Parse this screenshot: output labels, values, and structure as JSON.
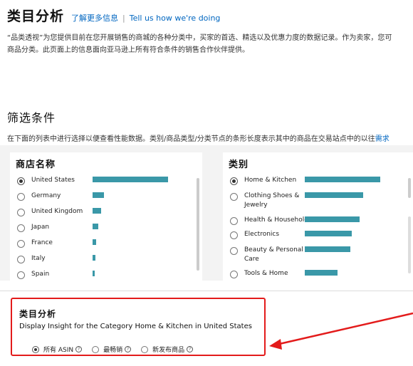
{
  "header": {
    "title": "类目分析",
    "learn_more": "了解更多信息",
    "separator": "|",
    "tell_us": "Tell us how we're doing",
    "desc_line1": "“品类透视”为您提供目前在您开展销售的商城的各种分类中，买家的首选、精选以及优惠力度的数据记录。作为卖家，您可",
    "desc_line2": "商品分类。此页面上的信息面向亚马逊上所有符合条件的销售合作伙伴提供。"
  },
  "filter": {
    "title": "筛选条件",
    "desc": "在下面的列表中进行选择以便查看性能数据。类别/商品类型/分类节点的条形长度表示其中的商品在交易站点中的以往",
    "desc_link": "需求"
  },
  "store_panel": {
    "title": "商店名称",
    "items": [
      {
        "label": "United States",
        "checked": true,
        "bar": 1.0
      },
      {
        "label": "Germany",
        "checked": false,
        "bar": 0.15
      },
      {
        "label": "United Kingdom",
        "checked": false,
        "bar": 0.11
      },
      {
        "label": "Japan",
        "checked": false,
        "bar": 0.08
      },
      {
        "label": "France",
        "checked": false,
        "bar": 0.05
      },
      {
        "label": "Italy",
        "checked": false,
        "bar": 0.04
      },
      {
        "label": "Spain",
        "checked": false,
        "bar": 0.03
      }
    ]
  },
  "category_panel": {
    "title": "类别",
    "items": [
      {
        "label": "Home & Kitchen",
        "checked": true,
        "bar": 1.0
      },
      {
        "label": "Clothing Shoes & Jewelry",
        "line1": "Clothing Shoes &",
        "line2": "Jewelry",
        "checked": false,
        "bar": 0.77
      },
      {
        "label": "Health & Household",
        "checked": false,
        "bar": 0.73
      },
      {
        "label": "Electronics",
        "checked": false,
        "bar": 0.62
      },
      {
        "label": "Beauty & Personal Care",
        "line1": "Beauty & Personal",
        "line2": "Care",
        "checked": false,
        "bar": 0.6
      },
      {
        "label": "Tools & Home",
        "checked": false,
        "bar": 0.43
      }
    ]
  },
  "insight": {
    "title": "类目分析",
    "subtitle": "Display Insight for the Category Home & Kitchen in United States",
    "options": [
      {
        "label": "所有 ASIN",
        "checked": true
      },
      {
        "label": "最畅销",
        "checked": false
      },
      {
        "label": "新发布商品",
        "checked": false
      }
    ],
    "help_glyph": "?"
  },
  "colors": {
    "bar": "#3a98a8",
    "link": "#0066c0",
    "highlight": "#e31b1b"
  }
}
